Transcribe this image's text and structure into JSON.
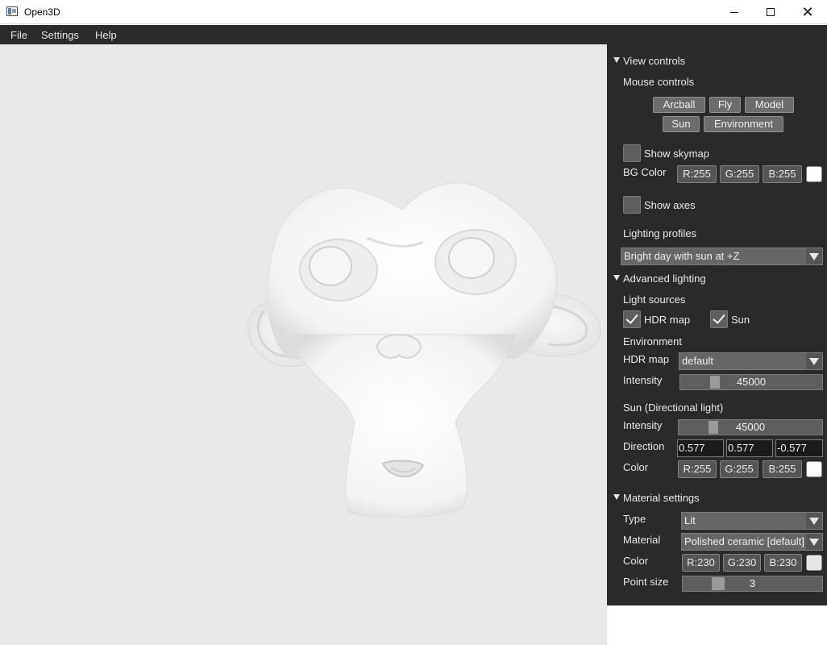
{
  "window": {
    "title": "Open3D"
  },
  "menu": {
    "items": [
      "File",
      "Settings",
      "Help"
    ]
  },
  "panel": {
    "view_controls": {
      "header": "View controls",
      "mouse_controls_label": "Mouse controls",
      "buttons": [
        "Arcball",
        "Fly",
        "Model",
        "Sun",
        "Environment"
      ],
      "show_skymap": {
        "label": "Show skymap",
        "checked": false
      },
      "bg_color": {
        "label": "BG Color",
        "r": "R:255",
        "g": "G:255",
        "b": "B:255",
        "swatch": "#ffffff"
      },
      "show_axes": {
        "label": "Show axes",
        "checked": false
      },
      "lighting_profiles_label": "Lighting profiles",
      "lighting_profile_value": "Bright day with sun at +Z"
    },
    "advanced_lighting": {
      "header": "Advanced lighting",
      "light_sources_label": "Light sources",
      "hdr_map_check": {
        "label": "HDR map",
        "checked": true
      },
      "sun_check": {
        "label": "Sun",
        "checked": true
      },
      "environment_label": "Environment",
      "hdr_map_label": "HDR map",
      "hdr_map_value": "default",
      "env_intensity_label": "Intensity",
      "env_intensity_value": "45000",
      "sun_section_label": "Sun (Directional light)",
      "sun_intensity_label": "Intensity",
      "sun_intensity_value": "45000",
      "direction_label": "Direction",
      "direction": [
        "0.577",
        "0.577",
        "-0.577"
      ],
      "sun_color": {
        "label": "Color",
        "r": "R:255",
        "g": "G:255",
        "b": "B:255",
        "swatch": "#ffffff"
      }
    },
    "material_settings": {
      "header": "Material settings",
      "type_label": "Type",
      "type_value": "Lit",
      "material_label": "Material",
      "material_value": "Polished ceramic [default]",
      "color": {
        "label": "Color",
        "r": "R:230",
        "g": "G:230",
        "b": "B:230",
        "swatch": "#e6e6e6"
      },
      "point_size_label": "Point size",
      "point_size_value": "3"
    }
  },
  "colors": {
    "panel_bg": "#2a2a2a",
    "viewport_bg": "#e9e9e9",
    "menubar_bg": "#2b2b2b"
  }
}
